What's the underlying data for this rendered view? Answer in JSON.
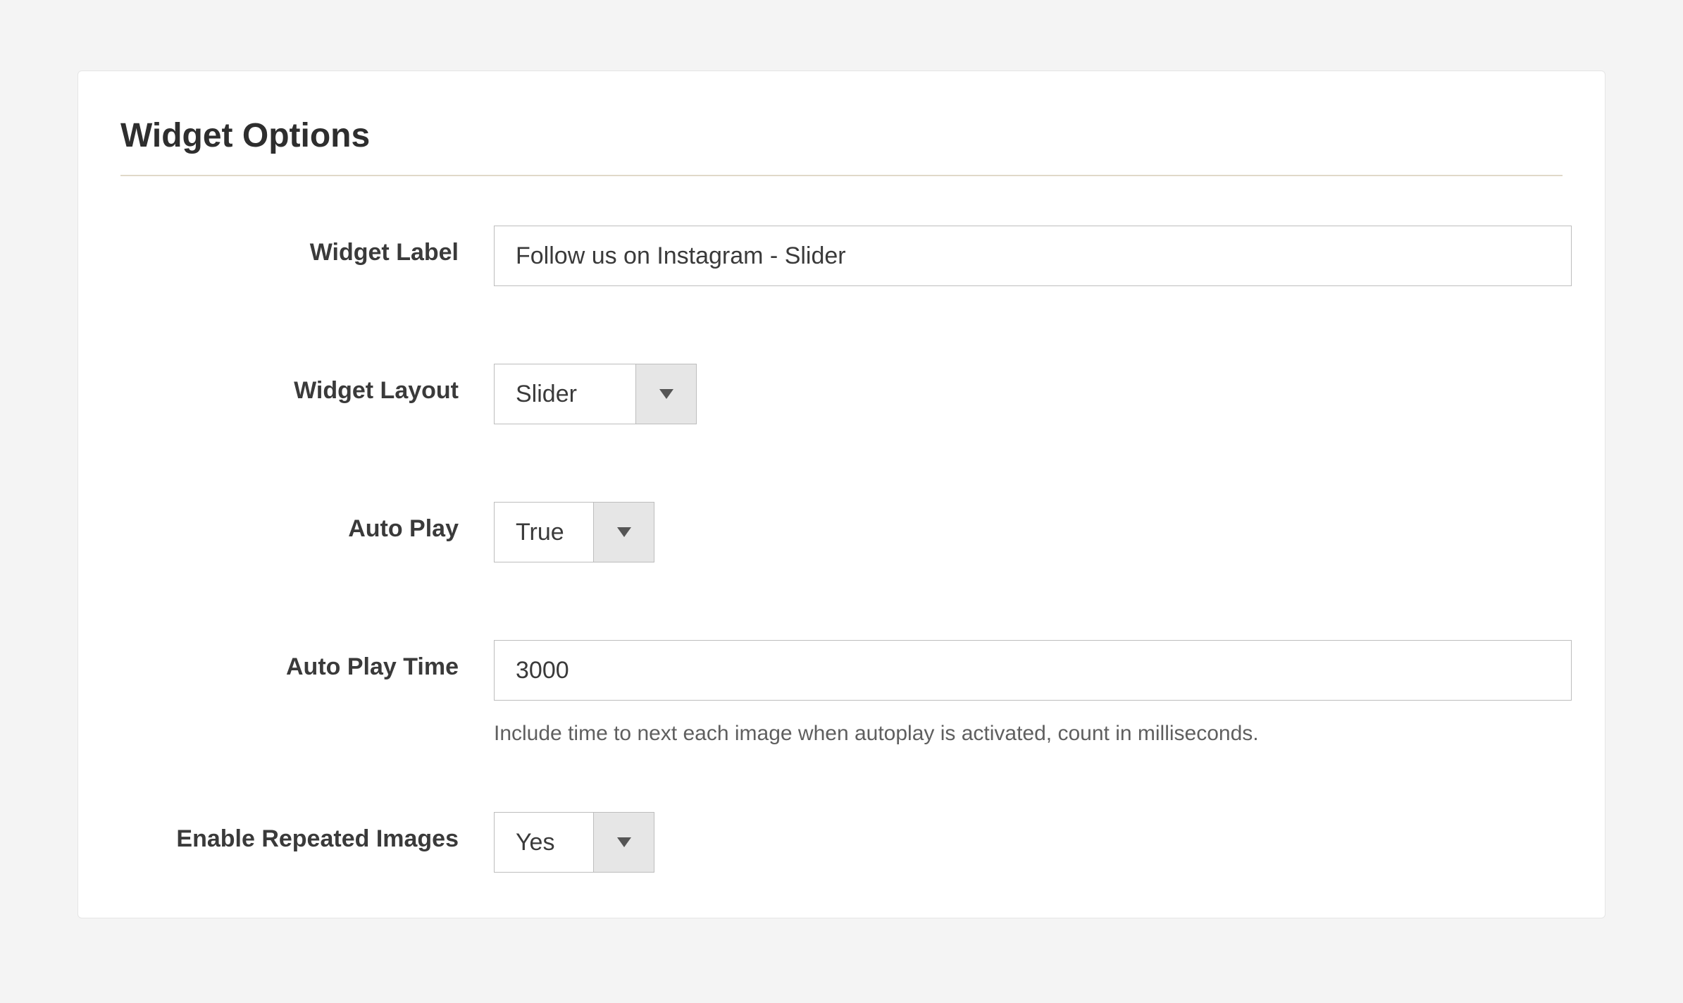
{
  "panel": {
    "title": "Widget Options"
  },
  "fields": {
    "widget_label": {
      "label": "Widget Label",
      "value": "Follow us on Instagram - Slider"
    },
    "widget_layout": {
      "label": "Widget Layout",
      "value": "Slider"
    },
    "auto_play": {
      "label": "Auto Play",
      "value": "True"
    },
    "auto_play_time": {
      "label": "Auto Play Time",
      "value": "3000",
      "helper": "Include time to next each image when autoplay is activated, count in milliseconds."
    },
    "enable_repeated_images": {
      "label": "Enable Repeated Images",
      "value": "Yes"
    }
  }
}
